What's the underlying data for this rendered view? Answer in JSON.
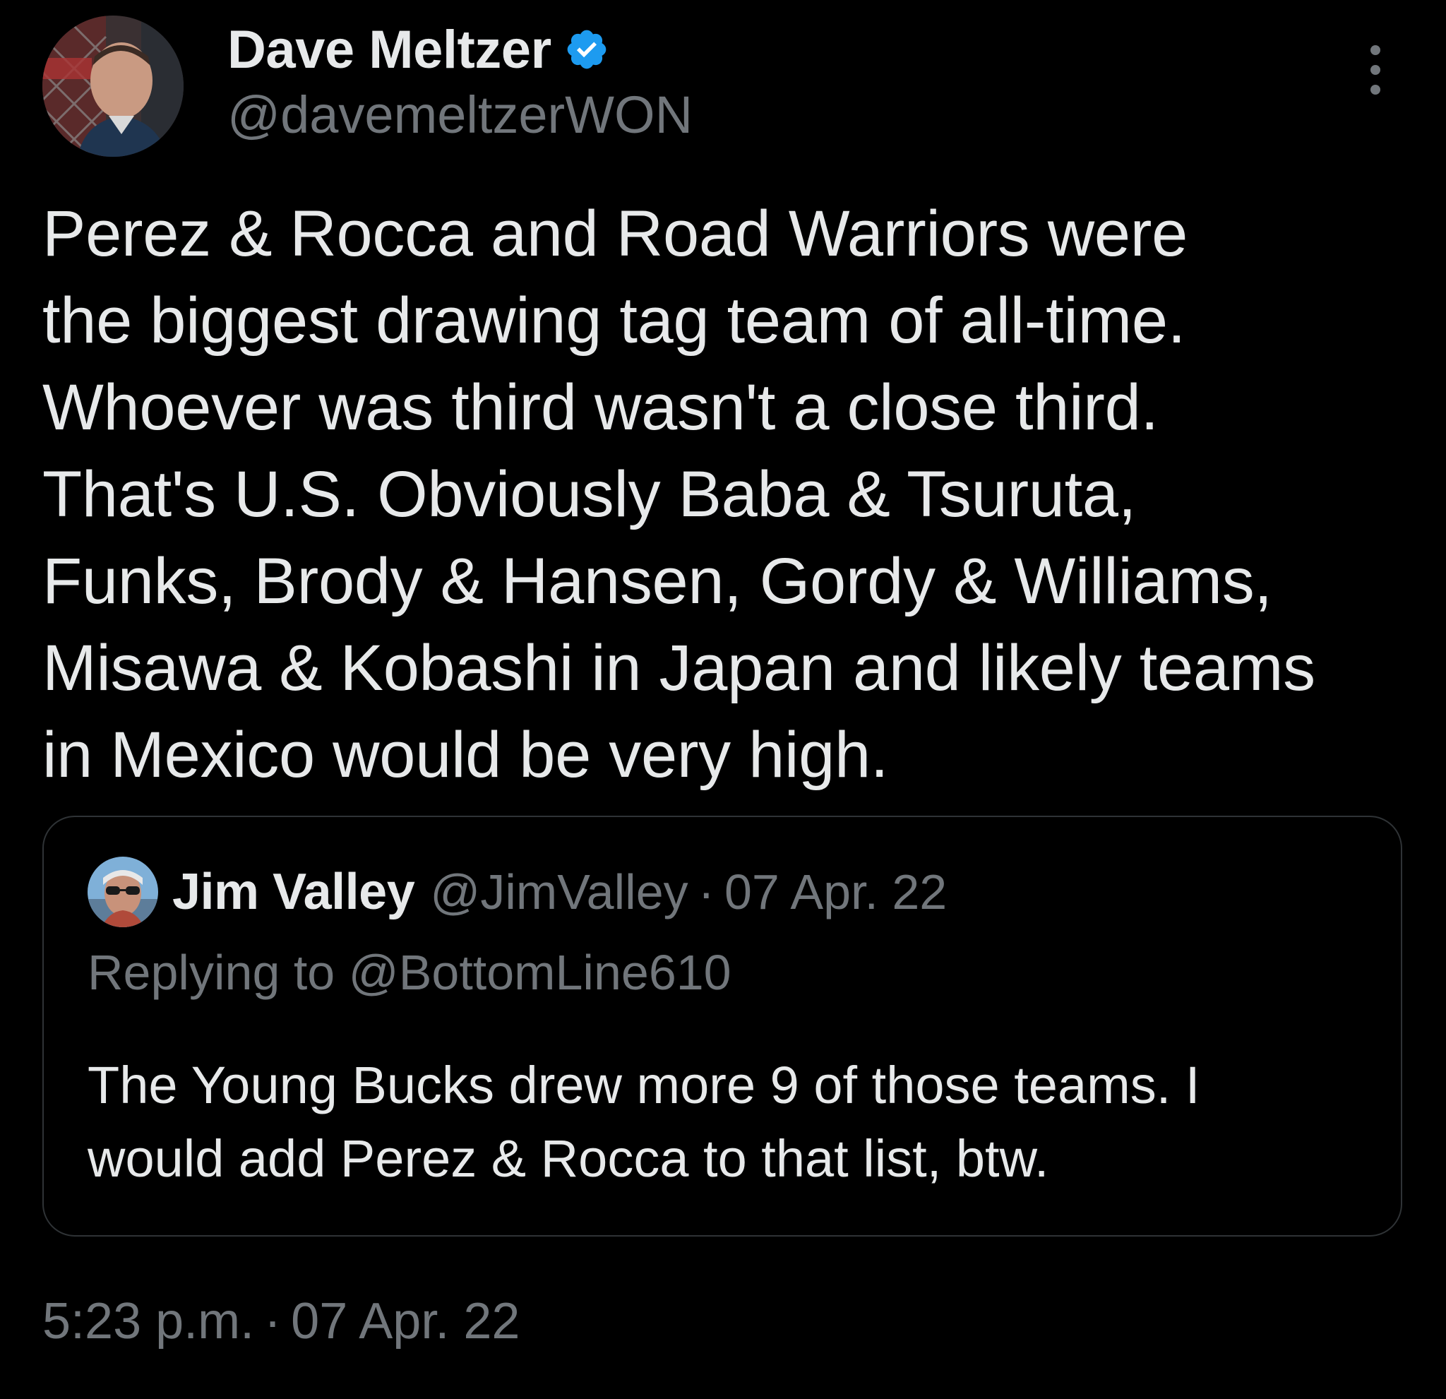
{
  "author": {
    "display_name": "Dave Meltzer",
    "handle": "@davemeltzerWON",
    "verified": true,
    "avatar_icon": "avatar-photo"
  },
  "tweet": {
    "text_lines": [
      "Perez & Rocca and Road Warriors were",
      "the biggest drawing tag team of all-time.",
      "Whoever was third wasn't a close third.",
      "That's U.S.  Obviously Baba & Tsuruta,",
      "Funks, Brody & Hansen, Gordy & Williams,",
      "Misawa & Kobashi in Japan and likely teams",
      "in Mexico would be very high."
    ],
    "time": "5:23 p.m.",
    "separator": "·",
    "date": "07 Apr. 22"
  },
  "quoted_tweet": {
    "display_name": "Jim Valley",
    "handle": "@JimValley",
    "separator": "·",
    "date": "07 Apr. 22",
    "replying_to": "Replying to @BottomLine610",
    "text_lines": [
      "The Young Bucks drew more 9 of those teams. I",
      "would add Perez & Rocca to that list, btw."
    ]
  },
  "icons": {
    "verified": "verified-badge-icon",
    "more": "more-options-icon"
  },
  "colors": {
    "background": "#000000",
    "primary_text": "#e7e9ea",
    "secondary_text": "#71767b",
    "verified_blue": "#1d9bf0",
    "border": "#2f3336"
  }
}
